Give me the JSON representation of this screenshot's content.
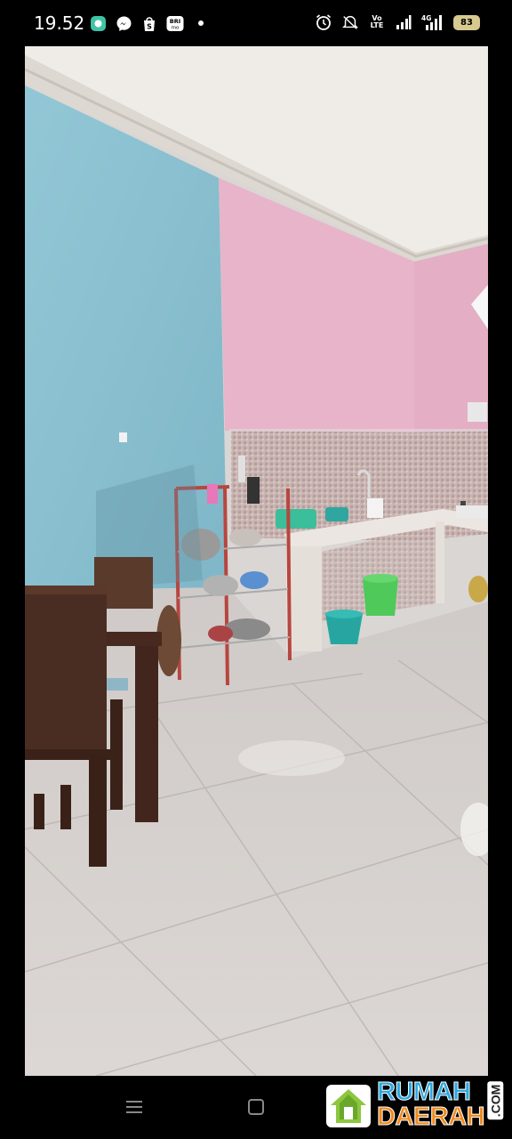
{
  "status_bar": {
    "time": "19.52",
    "left_icons": [
      "chat-bubble-icon",
      "messenger-icon",
      "shopee-bag-icon",
      "brimo-icon",
      "dot-icon"
    ],
    "brimo_label": "BRI\nmo",
    "right_icons": [
      "alarm-icon",
      "mute-vibrate-icon",
      "volte-icon",
      "signal-icon",
      "4g-signal-icon",
      "battery-icon"
    ],
    "volte_label": "Vo\nLTE",
    "network_label": "4G",
    "battery_level": "83"
  },
  "photo": {
    "subject": "kitchen-room",
    "colors": {
      "blue_wall": "#8ec3d3",
      "pink_wall": "#e8b3c8",
      "ceiling": "#efece8",
      "floor": "#d8d3cf",
      "tile_backsplash": "#c7b0ae",
      "wood": "#4a2e22",
      "rack_red": "#b7463f"
    }
  },
  "nav_bar": {
    "buttons": [
      "menu-icon",
      "home-square-icon",
      "back-icon"
    ]
  },
  "watermark": {
    "line1": "RUMAH",
    "line2": "DAERAH",
    "suffix": ".COM",
    "colors": {
      "rumah": "#2aa7e0",
      "daerah": "#f08a1c",
      "house": "#8dc63f"
    }
  }
}
